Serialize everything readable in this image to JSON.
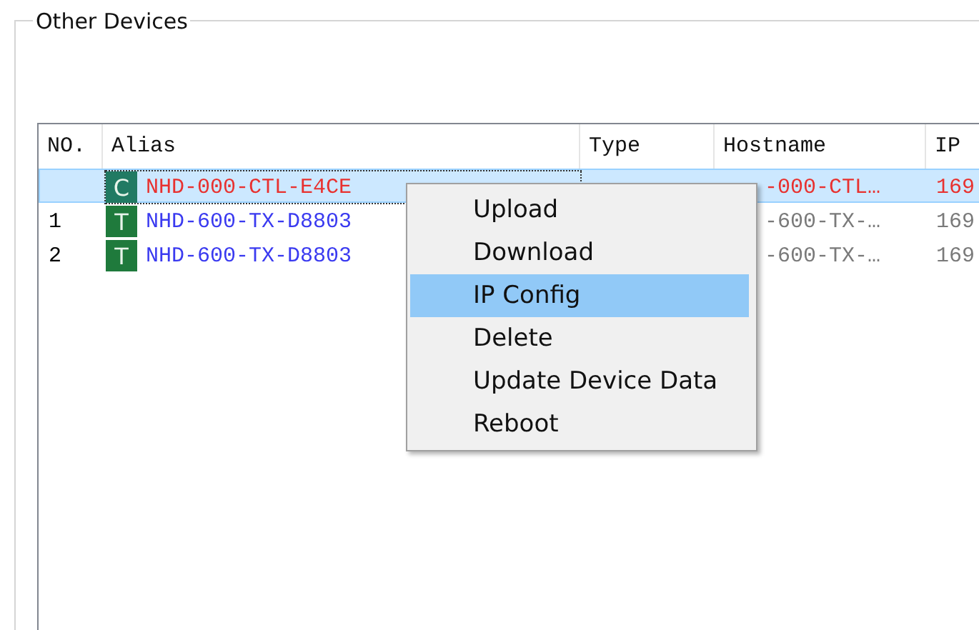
{
  "group": {
    "title": "Other Devices"
  },
  "table": {
    "columns": [
      "NO.",
      "Alias",
      "Type",
      "Hostname",
      "IP"
    ],
    "rows": [
      {
        "no": "",
        "kind": "controller",
        "badge": "C",
        "alias": "NHD-000-CTL-E4CE",
        "hostname": "-000-CTL…",
        "ip": "169",
        "color": "#e8312f",
        "selected": true
      },
      {
        "no": "1",
        "kind": "transmitter",
        "badge": "T",
        "alias": "NHD-600-TX-D8803",
        "hostname": "-600-TX-…",
        "ip": "169",
        "color": "#3a3af0",
        "selected": false
      },
      {
        "no": "2",
        "kind": "transmitter",
        "badge": "T",
        "alias": "NHD-600-TX-D8803",
        "hostname": "-600-TX-…",
        "ip": "169",
        "color": "#3a3af0",
        "selected": false
      }
    ]
  },
  "context_menu": {
    "items": [
      {
        "label": "Upload",
        "selected": false
      },
      {
        "label": "Download",
        "selected": false
      },
      {
        "label": "IP Config",
        "selected": true
      },
      {
        "label": "Delete",
        "selected": false
      },
      {
        "label": "Update Device Data",
        "selected": false
      },
      {
        "label": "Reboot",
        "selected": false
      }
    ]
  }
}
